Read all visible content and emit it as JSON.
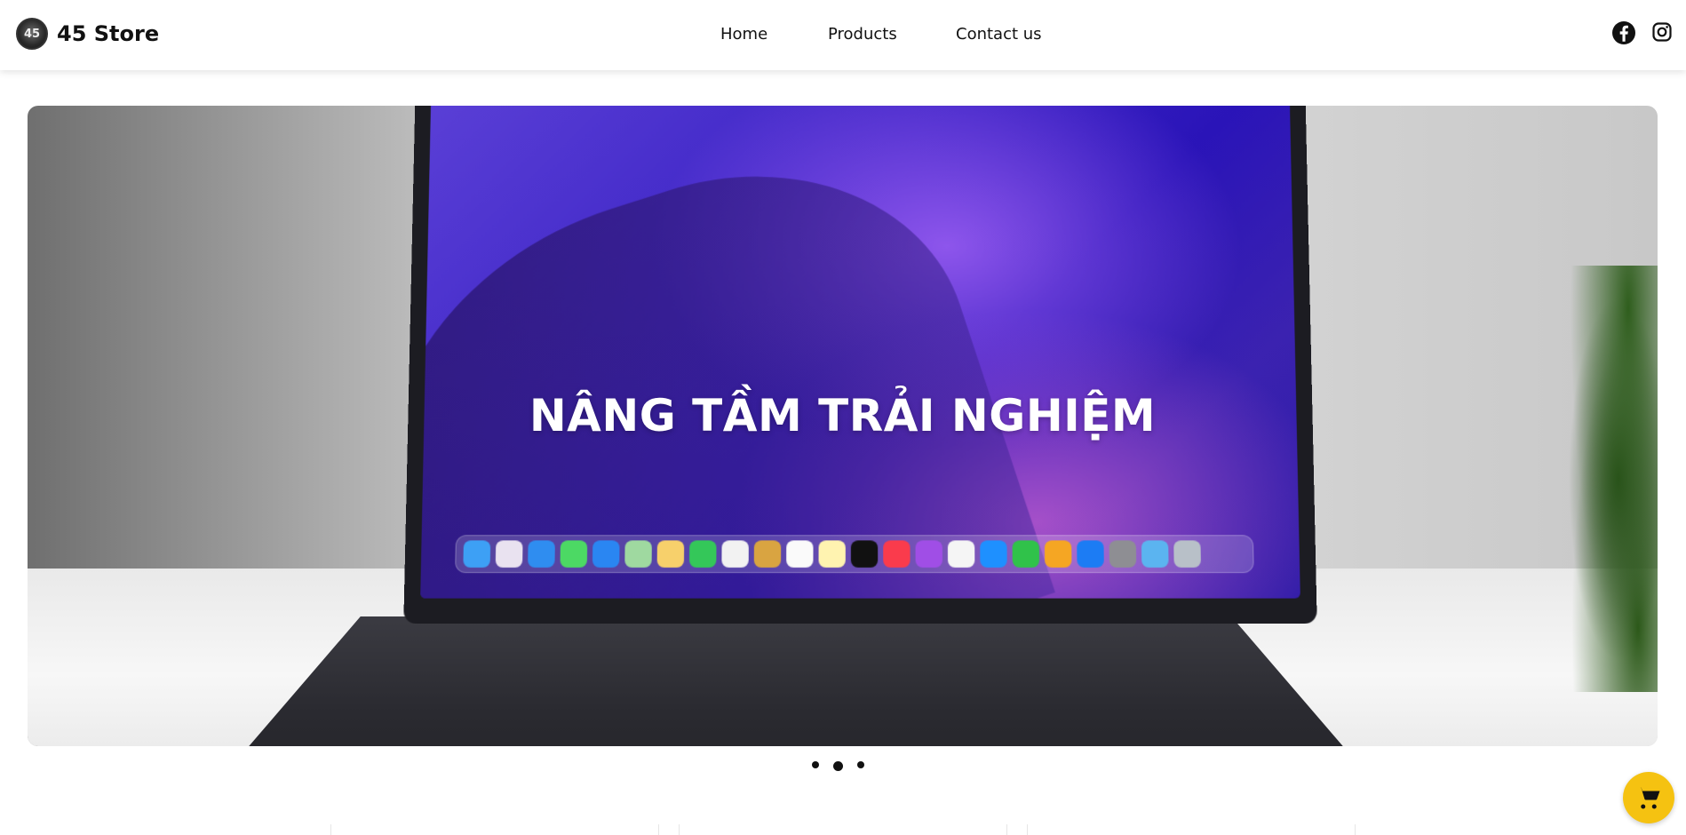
{
  "brand": {
    "logo_text": "45",
    "name": "45 Store"
  },
  "nav": {
    "home": "Home",
    "products": "Products",
    "contact": "Contact us"
  },
  "social": {
    "facebook": "facebook-icon",
    "instagram": "instagram-icon"
  },
  "hero": {
    "title": "NÂNG TẦM TRẢI NGHIỆM",
    "slide_count": 3,
    "active_slide": 2
  },
  "cart": {
    "icon": "cart-icon"
  },
  "colors": {
    "cart_accent": "#f5c211",
    "header_bg": "#ffffff",
    "text": "#111111"
  }
}
